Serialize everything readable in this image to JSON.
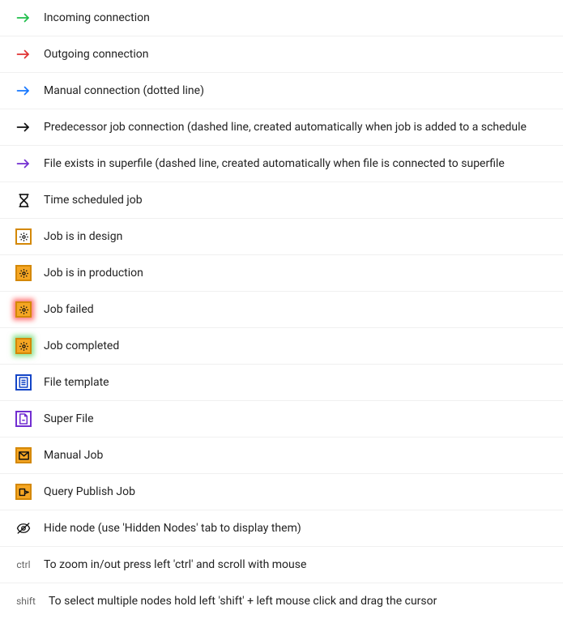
{
  "legend": [
    {
      "label": "Incoming connection"
    },
    {
      "label": "Outgoing connection"
    },
    {
      "label": "Manual connection (dotted line)"
    },
    {
      "label": "Predecessor job connection (dashed line, created automatically when job is added to a schedule"
    },
    {
      "label": "File exists in superfile (dashed line, created automatically when file is connected to superfile"
    },
    {
      "label": "Time scheduled job"
    },
    {
      "label": "Job is in design"
    },
    {
      "label": "Job is in production"
    },
    {
      "label": "Job failed"
    },
    {
      "label": "Job completed"
    },
    {
      "label": "File template"
    },
    {
      "label": "Super File"
    },
    {
      "label": "Manual Job"
    },
    {
      "label": "Query Publish Job"
    },
    {
      "label": "Hide node (use 'Hidden Nodes' tab to display them)"
    },
    {
      "label": "To zoom in/out press left 'ctrl' and scroll with mouse"
    },
    {
      "label": "To select multiple nodes hold left 'shift' + left mouse click and drag the cursor"
    }
  ],
  "keys": {
    "ctrl": "ctrl",
    "shift": "shift"
  }
}
